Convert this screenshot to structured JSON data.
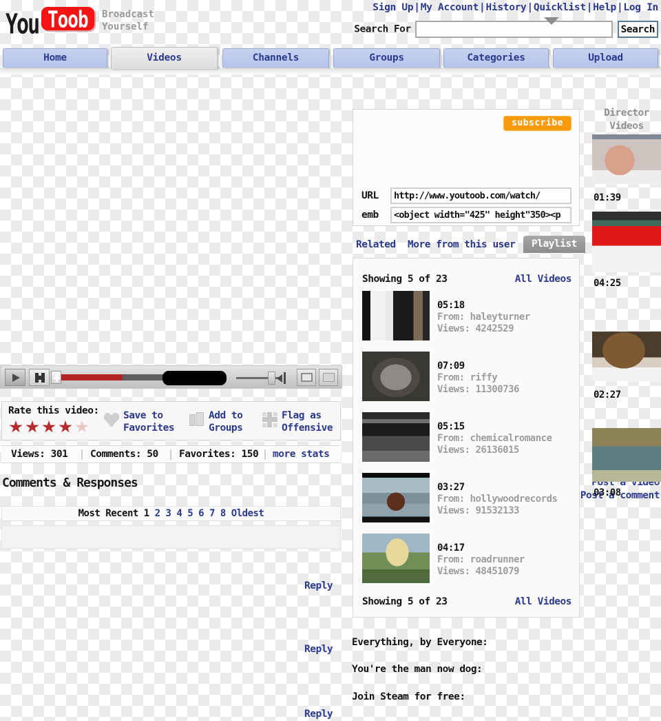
{
  "header": {
    "logo_you": "You",
    "logo_toob": "Toob",
    "tagline_line1": "Broadcast",
    "tagline_line2": "Yourself",
    "top_links": [
      "Sign Up",
      "My Account",
      "History",
      "Quicklist",
      "Help",
      "Log In"
    ],
    "search_label": "Search For",
    "search_value": "",
    "search_placeholder": "",
    "search_button": "Search"
  },
  "nav": {
    "tabs": [
      {
        "label": "Home",
        "active": false
      },
      {
        "label": "Videos",
        "active": true
      },
      {
        "label": "Channels",
        "active": false
      },
      {
        "label": "Groups",
        "active": false
      },
      {
        "label": "Categories",
        "active": false
      },
      {
        "label": "Upload",
        "active": false
      }
    ]
  },
  "player": {
    "progress_percent": 47,
    "time_display": "",
    "volume_percent": 72
  },
  "rate": {
    "title": "Rate this video:",
    "stars_filled": 4,
    "stars_total": 5,
    "actions": [
      {
        "label_line1": "Save to",
        "label_line2": "Favorites",
        "icon": "heart-icon"
      },
      {
        "label_line1": "Add to",
        "label_line2": "Groups",
        "icon": "folders-icon"
      },
      {
        "label_line1": "Flag as",
        "label_line2": "Offensive",
        "icon": "flag-icon"
      }
    ]
  },
  "stats": {
    "views": "Views: 301",
    "comments": "Comments: 50",
    "favorites": "Favorites: 150",
    "more_stats": "more stats"
  },
  "comments": {
    "title": "Comments & Responses",
    "post_video": "Post a video",
    "post_comment": "Post a comment",
    "pager_prefix": "Most Recent ",
    "pager_pages": [
      "1",
      "2",
      "3",
      "4",
      "5",
      "6",
      "7",
      "8"
    ],
    "pager_current": "1",
    "pager_suffix": "Oldest",
    "reply_label": "Reply"
  },
  "info_panel": {
    "subscribe_label": "subscribe",
    "url_label": "URL",
    "url_value": "http://www.youtoob.com/watch/",
    "emb_label": "emb",
    "emb_value": "<object width=\"425\" height\"350><p"
  },
  "related_tabs": [
    {
      "label": "Related",
      "active": false
    },
    {
      "label": "More from this user",
      "active": false
    },
    {
      "label": "Playlist",
      "active": true
    }
  ],
  "playlist": {
    "showing_top": "Showing 5 of 23",
    "showing_bottom": "Showing 5 of 23",
    "all_videos_top": "All Videos",
    "all_videos_bottom": "All Videos",
    "items": [
      {
        "time": "05:18",
        "from": "From: haleyturner",
        "views": "Views: 4242529"
      },
      {
        "time": "07:09",
        "from": "From: riffy",
        "views": "Views: 11300736"
      },
      {
        "time": "05:15",
        "from": "From: chemicalromance",
        "views": "Views: 26136015"
      },
      {
        "time": "03:27",
        "from": "From: hollywoodrecords",
        "views": "Views: 91532133"
      },
      {
        "time": "04:17",
        "from": "From: roadrunner",
        "views": "Views: 48451079"
      }
    ]
  },
  "sidebar": {
    "title_line1": "Director",
    "title_line2": "Videos",
    "items": [
      {
        "time": "01:39"
      },
      {
        "time": "04:25"
      },
      {
        "time": "02:27"
      },
      {
        "time": "03:08"
      }
    ]
  },
  "bottom_lines": [
    "Everything, by Everyone:",
    "You're the man now dog:",
    "Join Steam for free:"
  ],
  "colors": {
    "brand_red": "#f41414",
    "link_blue": "#2b3a8c",
    "subscribe_orange": "#f79a0e",
    "star_red": "#b52a2a",
    "progress_red": "#b52424"
  }
}
